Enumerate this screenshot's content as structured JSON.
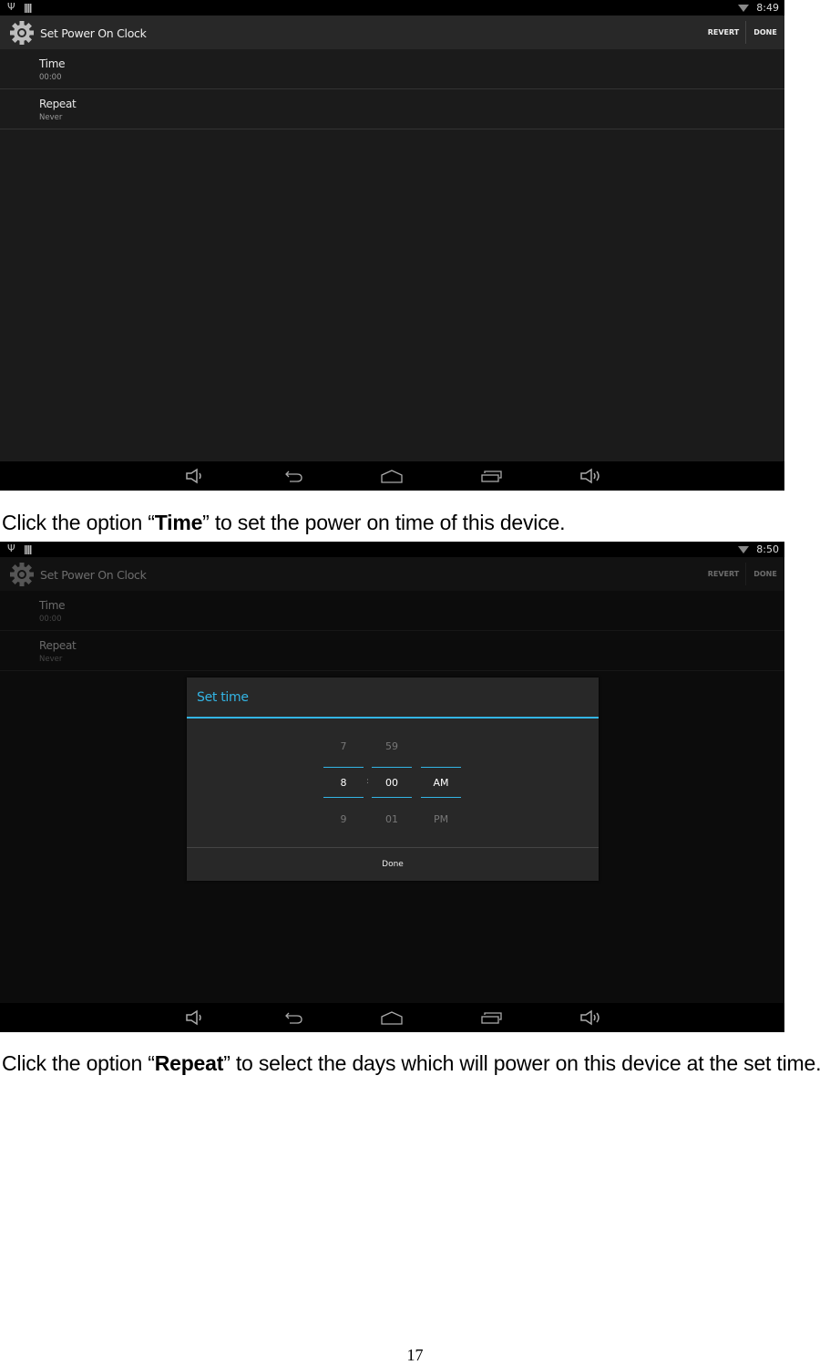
{
  "screens": [
    {
      "status_bar": {
        "time": "8:49",
        "icons": [
          "usb-icon",
          "sd-card-icon",
          "wifi-icon"
        ]
      },
      "action_bar": {
        "icon": "gear-icon",
        "title": "Set Power On Clock",
        "revert_label": "REVERT",
        "done_label": "DONE"
      },
      "preferences": [
        {
          "title": "Time",
          "summary": "00:00"
        },
        {
          "title": "Repeat",
          "summary": "Never"
        }
      ],
      "nav_bar": [
        "volume-down-icon",
        "back-icon",
        "home-icon",
        "recents-icon",
        "volume-up-icon"
      ]
    },
    {
      "status_bar": {
        "time": "8:50",
        "icons": [
          "usb-icon",
          "sd-card-icon",
          "wifi-icon"
        ]
      },
      "action_bar": {
        "icon": "gear-icon",
        "title": "Set Power On Clock",
        "revert_label": "REVERT",
        "done_label": "DONE"
      },
      "preferences": [
        {
          "title": "Time",
          "summary": "00:00"
        },
        {
          "title": "Repeat",
          "summary": "Never"
        }
      ],
      "dialog": {
        "title": "Set time",
        "hour": {
          "prev": "7",
          "current": "8",
          "next": "9"
        },
        "separator": ":",
        "minute": {
          "prev": "59",
          "current": "00",
          "next": "01"
        },
        "ampm": {
          "prev": "",
          "current": "AM",
          "next": "PM"
        },
        "done_label": "Done",
        "accent_color": "#33b5e5"
      },
      "nav_bar": [
        "volume-down-icon",
        "back-icon",
        "home-icon",
        "recents-icon",
        "volume-up-icon"
      ]
    }
  ],
  "captions": [
    {
      "pre": "Click the option “",
      "bold": "Time",
      "post": "” to set the power on time of this device."
    },
    {
      "pre": "Click the option “",
      "bold": "Repeat",
      "post": "” to select the days which will power on this device at the set time."
    }
  ],
  "page_number": "17"
}
